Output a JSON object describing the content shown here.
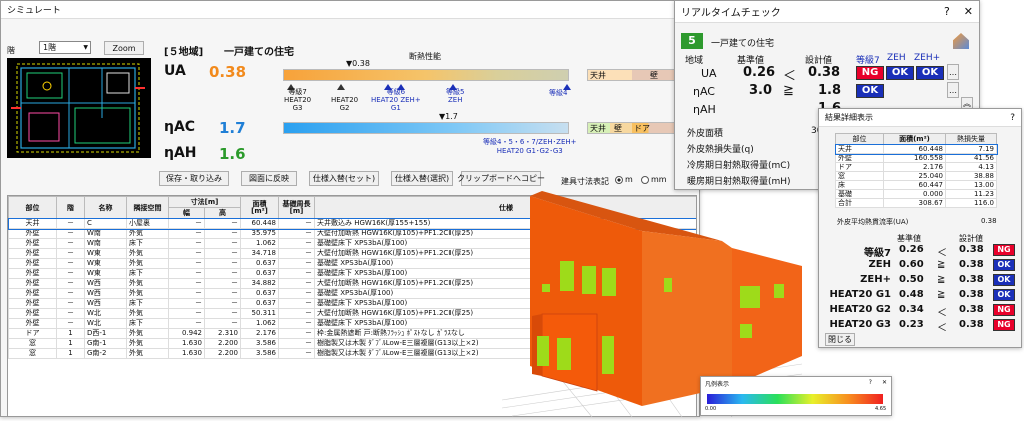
{
  "sim": {
    "title": "シミュレート",
    "floor_label": "階",
    "floor_value": "1階",
    "zoom_label": "Zoom",
    "region": "[５地域]",
    "house_type": "一戸建ての住宅",
    "ua_label": "UA",
    "ua_value": "0.38",
    "eta_ac_label": "ηAC",
    "eta_ac_value": "1.7",
    "eta_ah_label": "ηAH",
    "eta_ah_value": "1.6",
    "insulation_header": "断熱性能",
    "ua_marker": "▼0.38",
    "ua_scale": [
      {
        "id": "g7",
        "text": "等級7\nHEAT20\nG3",
        "color": "#333"
      },
      {
        "id": "g2",
        "text": "HEAT20\nG2",
        "color": "#333"
      },
      {
        "id": "g6",
        "text": "等級6\nHEAT20 ZEH+\nG1",
        "color": "#1a2fb8"
      },
      {
        "id": "g5",
        "text": "等級5\nZEH",
        "color": "#1a2fb8"
      },
      {
        "id": "g4",
        "text": "等級4",
        "color": "#1a2fb8"
      }
    ],
    "ac_marker": "▼1.7",
    "ac_scale_text": "等級4・5・6・7/ZEH･ZEH+\nHEAT20 G1･G2･G3",
    "room_labels": {
      "ceiling": "天井",
      "wall": "壁",
      "door": "ドア"
    },
    "buttons": {
      "save": "保存・取り込み",
      "reflect": "図面に反映",
      "spec_set": "仕様入替(セット)",
      "spec_sel": "仕様入替(選択)",
      "clipboard": "クリップボードへコピー"
    },
    "dim_notation": "建具寸法表記",
    "unit_m": "m",
    "unit_mm": "mm",
    "table": {
      "headers": [
        "部位",
        "階",
        "名称",
        "隣接空間",
        "寸法[m]",
        "面積\n[m²]",
        "基礎周長\n[m]",
        "仕様"
      ],
      "sub": [
        "幅",
        "高"
      ],
      "rows": [
        [
          "天井",
          "－",
          "C",
          "小屋裏",
          "－",
          "－",
          "60.448",
          "－",
          "天井敷込み HGW16K(厚155+155)"
        ],
        [
          "外壁",
          "－",
          "W南",
          "外気",
          "－",
          "－",
          "35.975",
          "－",
          "大壁付加断熱 HGW16K(厚105)+PF1.2CⅡ(厚25)"
        ],
        [
          "外壁",
          "－",
          "W南",
          "床下",
          "－",
          "－",
          "1.062",
          "－",
          "基礎壁床下 XPS3bA(厚100)"
        ],
        [
          "外壁",
          "－",
          "W東",
          "外気",
          "－",
          "－",
          "34.718",
          "－",
          "大壁付加断熱 HGW16K(厚105)+PF1.2CⅡ(厚25)"
        ],
        [
          "外壁",
          "－",
          "W東",
          "外気",
          "－",
          "－",
          "0.637",
          "－",
          "基礎壁 XPS3bA(厚100)"
        ],
        [
          "外壁",
          "－",
          "W東",
          "床下",
          "－",
          "－",
          "0.637",
          "－",
          "基礎壁床下 XPS3bA(厚100)"
        ],
        [
          "外壁",
          "－",
          "W西",
          "外気",
          "－",
          "－",
          "34.882",
          "－",
          "大壁付加断熱 HGW16K(厚105)+PF1.2CⅡ(厚25)"
        ],
        [
          "外壁",
          "－",
          "W西",
          "外気",
          "－",
          "－",
          "0.637",
          "－",
          "基礎壁 XPS3bA(厚100)"
        ],
        [
          "外壁",
          "－",
          "W西",
          "床下",
          "－",
          "－",
          "0.637",
          "－",
          "基礎壁床下 XPS3bA(厚100)"
        ],
        [
          "外壁",
          "－",
          "W北",
          "外気",
          "－",
          "－",
          "50.311",
          "－",
          "大壁付加断熱 HGW16K(厚105)+PF1.2CⅡ(厚25)"
        ],
        [
          "外壁",
          "－",
          "W北",
          "床下",
          "－",
          "－",
          "1.062",
          "－",
          "基礎壁床下 XPS3bA(厚100)"
        ],
        [
          "ドア",
          "1",
          "D西-1",
          "外気",
          "0.942",
          "2.310",
          "2.176",
          "－",
          "枠:金属熱遮断 戸:断熱ﾌﾗｯｼｭ ﾎﾟｽﾄなし ｶﾞﾗｽなし"
        ],
        [
          "窓",
          "1",
          "G南-1",
          "外気",
          "1.630",
          "2.200",
          "3.586",
          "－",
          "樹脂製又は木製 ﾀﾞﾌﾞﾙLow-E三層複層(G13以上×2)"
        ],
        [
          "窓",
          "1",
          "G南-2",
          "外気",
          "1.630",
          "2.200",
          "3.586",
          "－",
          "樹脂製又は木製 ﾀﾞﾌﾞﾙLow-E三層複層(G13以上×2)"
        ]
      ]
    }
  },
  "rt": {
    "title": "リアルタイムチェック",
    "help": "?",
    "close": "✕",
    "region_num": "5",
    "house_type": "一戸建ての住宅",
    "region_label": "地域",
    "std_label": "基準値",
    "design_label": "設計値",
    "hdr_g7": "等級7",
    "hdr_zeh": "ZEH",
    "hdr_zehp": "ZEH+",
    "ua_label": "UA",
    "ua_std": "0.26",
    "ua_cmp": "＜",
    "ua_design": "0.38",
    "ua_badges": [
      "NG",
      "OK",
      "OK"
    ],
    "ac_label": "ηAC",
    "ac_std": "3.0",
    "ac_cmp": "≧",
    "ac_design": "1.8",
    "ac_badges": [
      "OK"
    ],
    "ah_label": "ηAH",
    "ah_design": "1.6",
    "info": [
      "外皮面積",
      "外皮熱損失量(q)",
      "冷房期日射熱取得量(mC)",
      "暖房期日射熱取得量(mH)"
    ],
    "info_val": "30"
  },
  "detail": {
    "title": "結果詳細表示",
    "help": "?",
    "headers": [
      "部位",
      "面積(m²)",
      "熱損失量"
    ],
    "rows": [
      [
        "天井",
        "60.448",
        "7.19"
      ],
      [
        "外壁",
        "160.558",
        "41.56"
      ],
      [
        "ドア",
        "2.176",
        "4.13"
      ],
      [
        "窓",
        "25.040",
        "38.88"
      ],
      [
        "床",
        "60.447",
        "13.00"
      ],
      [
        "基礎",
        "0.000",
        "11.23"
      ],
      [
        "合計",
        "308.67",
        "116.0"
      ]
    ],
    "avg_label": "外皮平均熱貫流率(UA)",
    "avg_value": "0.38",
    "crit_std": "基準値",
    "crit_design": "設計値",
    "criteria": [
      {
        "label": "等級7",
        "std": "0.26",
        "cmp": "＜",
        "design": "0.38",
        "result": "NG"
      },
      {
        "label": "ZEH",
        "std": "0.60",
        "cmp": "≧",
        "design": "0.38",
        "result": "OK"
      },
      {
        "label": "ZEH+",
        "std": "0.50",
        "cmp": "≧",
        "design": "0.38",
        "result": "OK"
      },
      {
        "label": "HEAT20 G1",
        "std": "0.48",
        "cmp": "≧",
        "design": "0.38",
        "result": "OK"
      },
      {
        "label": "HEAT20 G2",
        "std": "0.34",
        "cmp": "＜",
        "design": "0.38",
        "result": "NG"
      },
      {
        "label": "HEAT20 G3",
        "std": "0.23",
        "cmp": "＜",
        "design": "0.38",
        "result": "NG"
      }
    ],
    "close": "閉じる"
  },
  "legend": {
    "title": "凡例表示",
    "help": "?",
    "close": "✕",
    "min": "0.00",
    "max": "4.65"
  },
  "colors": {
    "ng": "#e8002a",
    "ok": "#1a2fb8",
    "ua_value": "#f28a1c",
    "eta_value": "#1f7fd6",
    "eta_ah_value": "#2a9a2a",
    "house_orange": "#f25a0a",
    "house_window": "#9edb1a"
  }
}
